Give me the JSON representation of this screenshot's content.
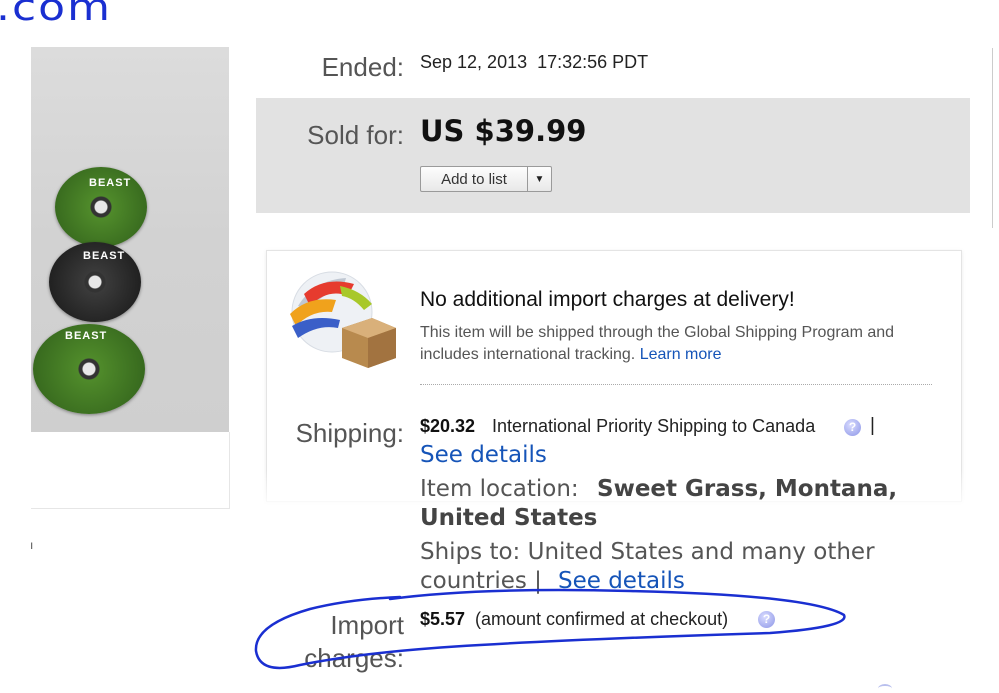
{
  "annotation": {
    "scribble": ".com"
  },
  "image": {
    "disc_labels": [
      "BEAST",
      "BEAST",
      "BEAST"
    ],
    "side_mark": "ı"
  },
  "listing": {
    "ended_label": "Ended:",
    "ended_value": "Sep 12, 2013  17:32:56 PDT",
    "sold_label": "Sold for:",
    "price": "US $39.99",
    "add_to_list": "Add to list",
    "add_to_list_arrow": "▼"
  },
  "gsp": {
    "title": "No additional import charges at delivery!",
    "desc": "This item will be shipped through the Global Shipping Program and includes international tracking.",
    "learn_more": "Learn more",
    "icon": "global-shipping-box-icon"
  },
  "shipping": {
    "label": "Shipping:",
    "cost": "$20.32",
    "method": "International Priority Shipping to Canada",
    "pipe": "|",
    "see_details": "See details",
    "location_prefix": "Item location:",
    "location_line1": "Sweet Grass, Montana,",
    "location_line2": "United States",
    "ships_to_line1": "Ships to: United States and many other",
    "ships_to_line2": "countries |",
    "see_details_2": "See details"
  },
  "import": {
    "label": "Import charges:",
    "cost": "$5.57",
    "note": "(amount confirmed at checkout)"
  },
  "colors": {
    "link": "#1554b8",
    "annotation_ink": "#1a2fd1",
    "panel": "#e2e2e2"
  }
}
